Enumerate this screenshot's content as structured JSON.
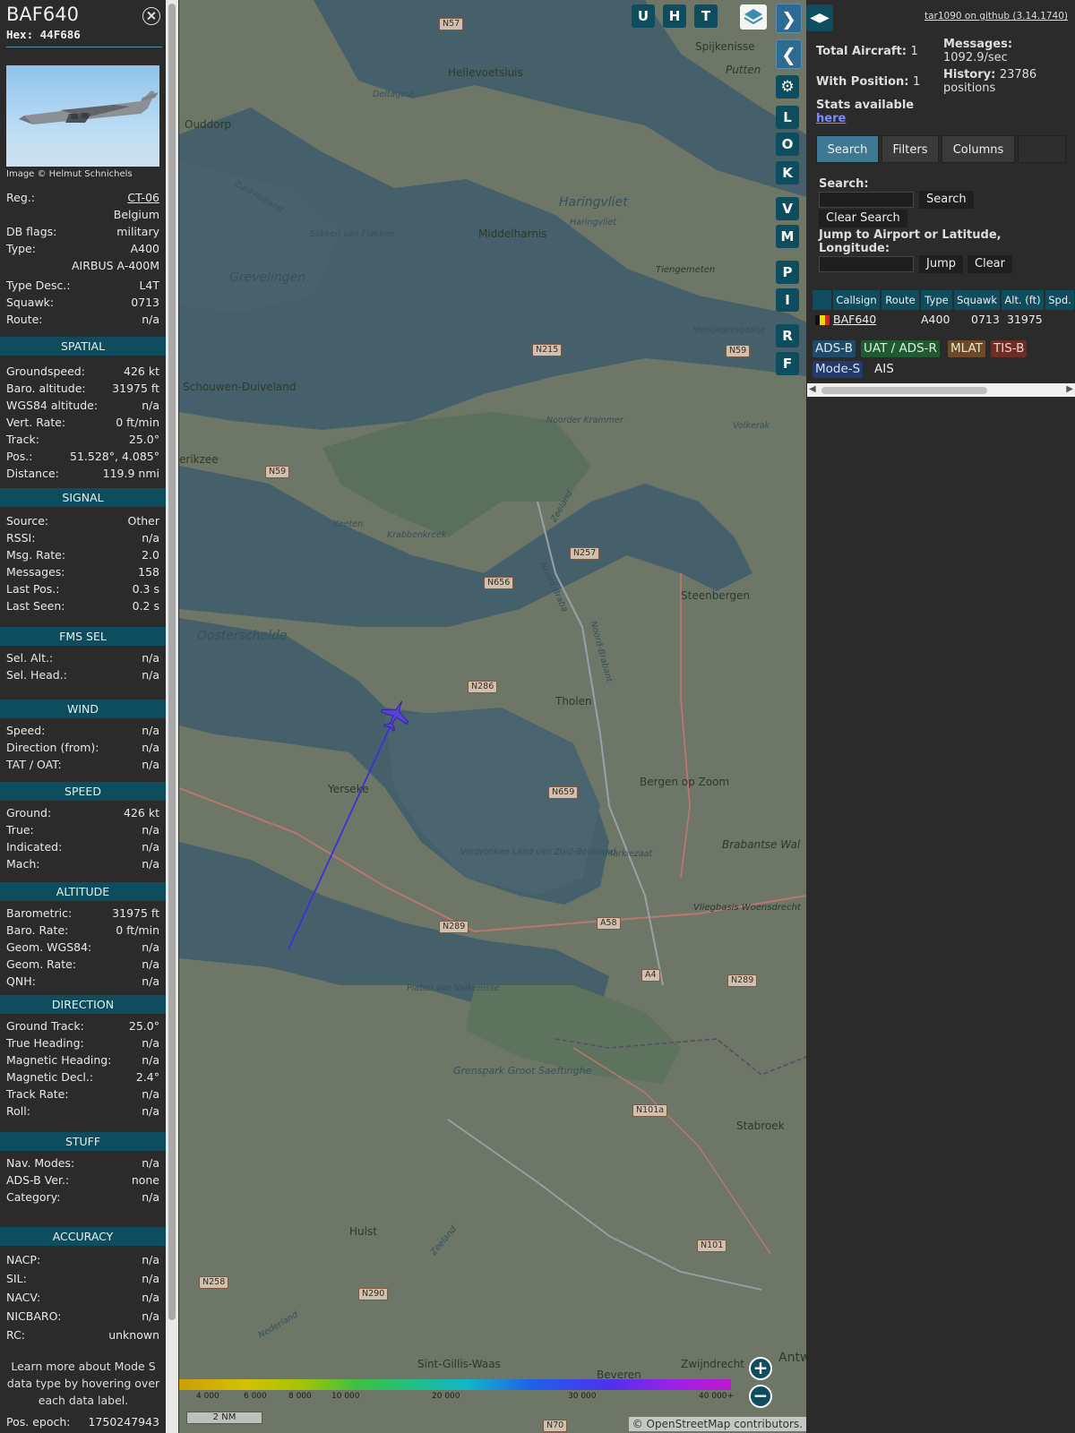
{
  "aircraft": {
    "callsign": "BAF640",
    "hex_label": "Hex:",
    "hex": "44F686",
    "image_credit": "Image © Helmut Schnichels"
  },
  "details": [
    {
      "k": "Reg.:",
      "v": "CT-06",
      "link": true
    },
    {
      "k": "",
      "v": "Belgium"
    },
    {
      "k": "DB flags:",
      "v": "military"
    },
    {
      "k": "Type:",
      "v": "A400"
    },
    {
      "k": "",
      "v": "AIRBUS A-400M"
    },
    {
      "k": "Type Desc.:",
      "v": "L4T"
    },
    {
      "k": "Squawk:",
      "v": "0713"
    },
    {
      "k": "Route:",
      "v": "n/a"
    }
  ],
  "sections": [
    {
      "title": "SPATIAL",
      "rows": [
        {
          "k": "Groundspeed:",
          "v": "426 kt"
        },
        {
          "k": "Baro. altitude:",
          "v": "31975 ft"
        },
        {
          "k": "WGS84 altitude:",
          "v": "n/a"
        },
        {
          "k": "Vert. Rate:",
          "v": "0 ft/min"
        },
        {
          "k": "Track:",
          "v": "25.0°"
        },
        {
          "k": "Pos.:",
          "v": "51.528°, 4.085°"
        },
        {
          "k": "Distance:",
          "v": "119.9 nmi"
        }
      ]
    },
    {
      "title": "SIGNAL",
      "rows": [
        {
          "k": "Source:",
          "v": "Other"
        },
        {
          "k": "RSSI:",
          "v": "n/a"
        },
        {
          "k": "Msg. Rate:",
          "v": "2.0"
        },
        {
          "k": "Messages:",
          "v": "158"
        },
        {
          "k": "Last Pos.:",
          "v": "0.3 s"
        },
        {
          "k": "Last Seen:",
          "v": "0.2 s"
        }
      ]
    },
    {
      "title": "FMS SEL",
      "rows": [
        {
          "k": "Sel. Alt.:",
          "v": "n/a"
        },
        {
          "k": "Sel. Head.:",
          "v": "n/a"
        }
      ]
    },
    {
      "title": "WIND",
      "rows": [
        {
          "k": "Speed:",
          "v": "n/a"
        },
        {
          "k": "Direction (from):",
          "v": "n/a"
        },
        {
          "k": "TAT / OAT:",
          "v": "n/a"
        }
      ]
    },
    {
      "title": "SPEED",
      "rows": [
        {
          "k": "Ground:",
          "v": "426 kt"
        },
        {
          "k": "True:",
          "v": "n/a"
        },
        {
          "k": "Indicated:",
          "v": "n/a"
        },
        {
          "k": "Mach:",
          "v": "n/a"
        }
      ]
    },
    {
      "title": "ALTITUDE",
      "rows": [
        {
          "k": "Barometric:",
          "v": "31975 ft"
        },
        {
          "k": "Baro. Rate:",
          "v": "0 ft/min"
        },
        {
          "k": "Geom. WGS84:",
          "v": "n/a"
        },
        {
          "k": "Geom. Rate:",
          "v": "n/a"
        },
        {
          "k": "QNH:",
          "v": "n/a"
        }
      ]
    },
    {
      "title": "DIRECTION",
      "rows": [
        {
          "k": "Ground Track:",
          "v": "25.0°"
        },
        {
          "k": "True Heading:",
          "v": "n/a"
        },
        {
          "k": "Magnetic Heading:",
          "v": "n/a"
        },
        {
          "k": "Magnetic Decl.:",
          "v": "2.4°"
        },
        {
          "k": "Track Rate:",
          "v": "n/a"
        },
        {
          "k": "Roll:",
          "v": "n/a"
        }
      ]
    },
    {
      "title": "STUFF",
      "rows": [
        {
          "k": "Nav. Modes:",
          "v": "n/a"
        },
        {
          "k": "ADS-B Ver.:",
          "v": "none"
        },
        {
          "k": "Category:",
          "v": "n/a"
        }
      ]
    },
    {
      "title": "ACCURACY",
      "rows": [
        {
          "k": "NACP:",
          "v": "n/a"
        },
        {
          "k": "SIL:",
          "v": "n/a"
        },
        {
          "k": "NACV:",
          "v": "n/a"
        },
        {
          "k": "NICBARO:",
          "v": "n/a"
        },
        {
          "k": "RC:",
          "v": "unknown"
        }
      ]
    }
  ],
  "note": "Learn more about Mode S data type by hovering over each data label.",
  "epoch": {
    "k": "Pos. epoch:",
    "v": "1750247943"
  },
  "map": {
    "top_buttons": [
      "U",
      "H",
      "T"
    ],
    "side_buttons": [
      "L",
      "O",
      "K",
      "V",
      "M",
      "P",
      "I",
      "R",
      "F"
    ],
    "labels": {
      "n57": "N57",
      "spijkenisse": "Spijkenisse",
      "putten": "Putten",
      "hellevoetsluis": "Hellevoetsluis",
      "ouddorp": "Ouddorp",
      "deltageul": "Deltageul",
      "haringvliet": "Haringvliet",
      "haringvliet2": "Haringvliet",
      "middelharnis": "Middelharnis",
      "zuidholland": "Zuid-Holland",
      "slikken": "Slikken van Flakkee",
      "grevelingen": "Grevelingen",
      "tiengemeten": "Tiengemeten",
      "ventjagers": "Ventjagersgaatje",
      "n215": "N215",
      "n59a": "N59",
      "schouwen": "Schouwen-Duiveland",
      "noorder": "Noorder Krammer",
      "volkerak": "Volkerak",
      "erikzee": "erikzee",
      "n59b": "N59",
      "zeeland": "Zeeland",
      "keeten": "Keeten",
      "krabbenkreek": "Krabbenkreek",
      "n257": "N257",
      "n656": "N656",
      "noordbraba": "Noord-Braba",
      "noordbrabant": "Noord-Brabant",
      "steenbergen": "Steenbergen",
      "oosterschelde": "Oosterschelde",
      "n286": "N286",
      "tholen": "Tholen",
      "yerseke": "Yerseke",
      "n659": "N659",
      "bergen": "Bergen op Zoom",
      "brabantse": "Brabantse Wal",
      "verdronken": "Verdronken Land van Zuid-Beveland",
      "markiezaat": "Markiezaat",
      "vliegbasis": "Vliegbasis Woensdrecht",
      "n289a": "N289",
      "a58": "A58",
      "a4": "A4",
      "n289b": "N289",
      "platen": "Platen van Valkenisse",
      "grenspark": "Grenspark Groot Saeftinghe",
      "n101a": "N101a",
      "stabroek": "Stabroek",
      "hulst": "Hulst",
      "n101": "N101",
      "n258": "N258",
      "n290": "N290",
      "sintgillis": "Sint-Gillis-Waas",
      "beveren": "Beveren",
      "zwijndrecht": "Zwijndrecht",
      "antw": "Antw",
      "n70": "N70",
      "nederland": "Nederland",
      "zeeland2": "Zeeland"
    },
    "colorbar_ticks": [
      "4 000",
      "6 000",
      "8 000",
      "10 000",
      "20 000",
      "30 000",
      "40 000+"
    ],
    "scale": "2 NM",
    "attribution": "© OpenStreetMap contributors."
  },
  "side": {
    "github": "tar1090 on github (3.14.1740)",
    "total_label": "Total Aircraft:",
    "total": "1",
    "withpos_label": "With Position:",
    "withpos": "1",
    "messages_label": "Messages:",
    "messages": "1092.9/sec",
    "history_label": "History:",
    "history": "23786 positions",
    "stats_label": "Stats available",
    "stats_link": "here",
    "tabs": [
      "Search",
      "Filters",
      "Columns"
    ],
    "search_label": "Search:",
    "search_btn": "Search",
    "clear_search_btn": "Clear Search",
    "jump_label": "Jump to Airport or Latitude, Longitude:",
    "jump_btn": "Jump",
    "clear_btn": "Clear",
    "columns": [
      "Callsign",
      "Route",
      "Type",
      "Squawk",
      "Alt. (ft)",
      "Spd."
    ],
    "rows": [
      {
        "callsign": "BAF640",
        "route": "",
        "type": "A400",
        "squawk": "0713",
        "alt": "31975"
      }
    ],
    "legend": [
      {
        "label": "ADS-B",
        "bg": "#1f4a6a",
        "fg": "#d7e6f0"
      },
      {
        "label": "UAT / ADS-R",
        "bg": "#1f5a32",
        "fg": "#d9eedd"
      },
      {
        "label": "MLAT",
        "bg": "#6b4a2a",
        "fg": "#f2e2cc"
      },
      {
        "label": "TIS-B",
        "bg": "#6b2d25",
        "fg": "#f2d2cc"
      },
      {
        "label": "Mode-S",
        "bg": "#243a6b",
        "fg": "#d7defa"
      },
      {
        "label": "AIS",
        "bg": "#2b2b2b",
        "fg": "#eeeeee"
      }
    ]
  }
}
